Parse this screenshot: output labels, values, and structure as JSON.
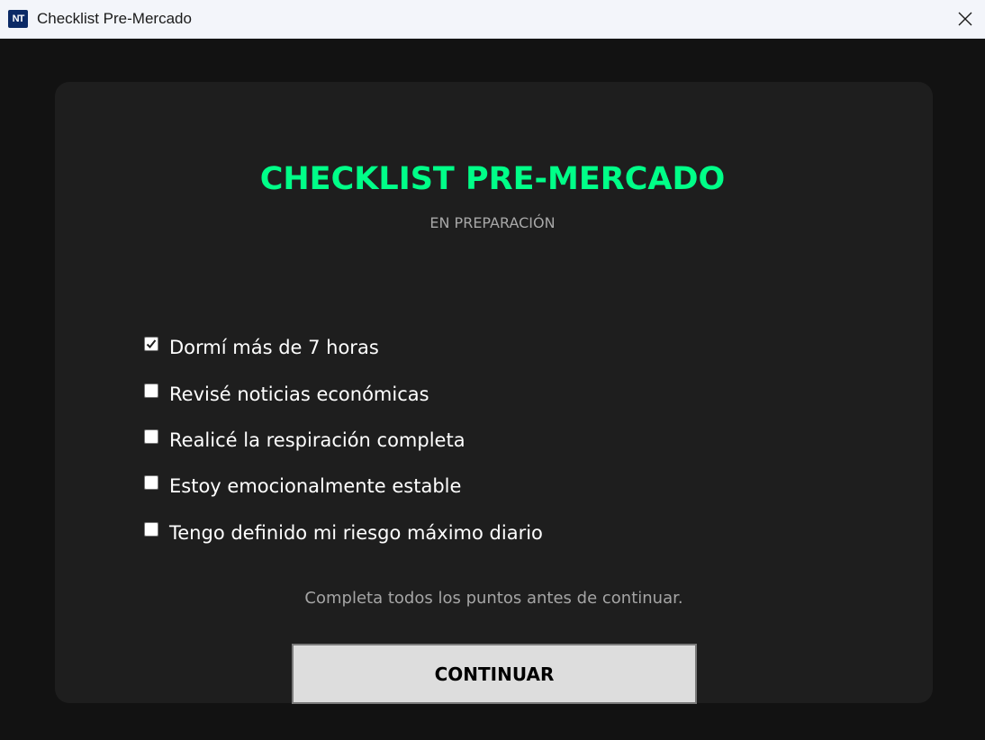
{
  "window": {
    "app_icon_text": "NT",
    "title": "Checklist Pre-Mercado"
  },
  "checklist": {
    "title": "CHECKLIST PRE-MERCADO",
    "subtitle": "EN PREPARACIÓN",
    "items": [
      {
        "label": "Dormí más de 7 horas",
        "checked": true
      },
      {
        "label": "Revisé noticias económicas",
        "checked": false
      },
      {
        "label": "Realicé la respiración completa",
        "checked": false
      },
      {
        "label": "Estoy emocionalmente estable",
        "checked": false
      },
      {
        "label": "Tengo definido mi riesgo máximo diario",
        "checked": false
      }
    ],
    "hint": "Completa todos los puntos antes de continuar.",
    "continue_label": "CONTINUAR"
  },
  "colors": {
    "accent": "#00ff88",
    "background": "#121212",
    "card": "#1e1e1e",
    "button": "#dddddd"
  },
  "icons": {
    "app": "nt-logo-icon",
    "close": "close-icon",
    "check": "checkmark-icon"
  }
}
